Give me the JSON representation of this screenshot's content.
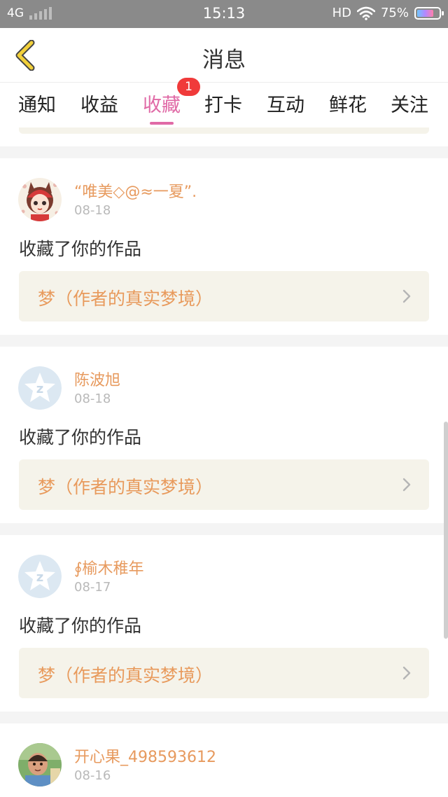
{
  "status_bar": {
    "network": "4G",
    "time": "15:13",
    "hd": "HD",
    "battery": "75%",
    "battery_level": 0.75
  },
  "header": {
    "title": "消息",
    "back_icon": "chevron-left-icon",
    "accent_color": "#f2d03a"
  },
  "tabs": {
    "items": [
      {
        "label": "通知"
      },
      {
        "label": "收益"
      },
      {
        "label": "收藏",
        "active": true,
        "badge": "1"
      },
      {
        "label": "打卡"
      },
      {
        "label": "互动"
      },
      {
        "label": "鲜花"
      },
      {
        "label": "关注"
      }
    ],
    "active_color": "#e06aa6",
    "badge_color": "#f03a3a"
  },
  "messages": [
    {
      "name": "“唯美◇@≈一夏”.",
      "date": "08-18",
      "action": "收藏了你的作品",
      "work": "梦（作者的真实梦境）",
      "avatar": "cartoon-girl-avatar"
    },
    {
      "name": "陈波旭",
      "date": "08-18",
      "action": "收藏了你的作品",
      "work": "梦（作者的真实梦境）",
      "avatar": "default-qzone-avatar"
    },
    {
      "name": "∮榆木稚年",
      "date": "08-17",
      "action": "收藏了你的作品",
      "work": "梦（作者的真实梦境）",
      "avatar": "default-qzone-avatar"
    },
    {
      "name": "开心果_498593612",
      "date": "08-16",
      "avatar": "photo-child-avatar"
    }
  ],
  "colors": {
    "username": "#e79a5e",
    "work_title": "#e89a5c",
    "work_bg": "#f5f3ea"
  }
}
